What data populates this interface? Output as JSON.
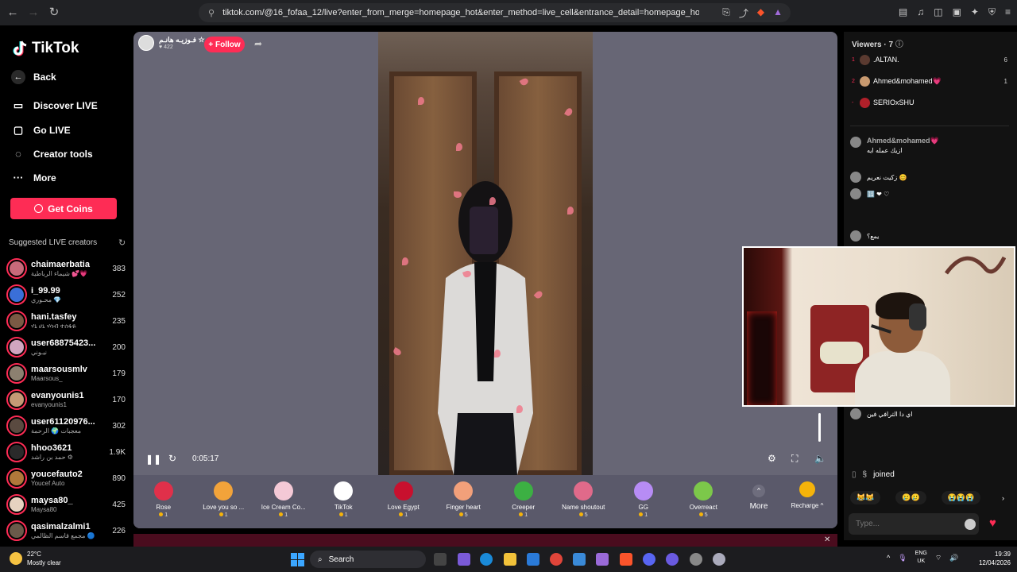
{
  "browser": {
    "url": "tiktok.com/@16_fofaa_12/live?enter_from_merge=homepage_hot&enter_method=live_cell&entrance_detail=homepage_hot_live_cell&from_pla..."
  },
  "sidebar": {
    "brand": "TikTok",
    "back": "Back",
    "nav": [
      "Discover LIVE",
      "Go LIVE",
      "Creator tools",
      "More"
    ],
    "get_coins": "Get Coins",
    "suggested_title": "Suggested LIVE creators",
    "creators": [
      {
        "name": "chaimaerbatia",
        "sub": "شيماء الرباطية 💕💗",
        "count": "383",
        "color": "#c86a7a"
      },
      {
        "name": "i_99.99",
        "sub": "محـوري 💎",
        "count": "252",
        "color": "#3a6fd8"
      },
      {
        "name": "hani.tasfey",
        "sub": "ሃኒ ሀኒ ሃሳብ ተሰፋዬ",
        "count": "235",
        "color": "#7a5a44"
      },
      {
        "name": "user68875423...",
        "sub": "نيـوني",
        "count": "200",
        "color": "#d1a6c0"
      },
      {
        "name": "maarsousmlv",
        "sub": "Maarsous_",
        "count": "179",
        "color": "#8c8070"
      },
      {
        "name": "evanyounis1",
        "sub": "evanyounis1",
        "count": "170",
        "color": "#c59a76"
      },
      {
        "name": "user61120976...",
        "sub": "معجبات 🌍 الرحمة",
        "count": "302",
        "color": "#5a4a40"
      },
      {
        "name": "hhoo3621",
        "sub": "حمد بن راشد ⚙",
        "count": "1.9K",
        "color": "#2a2a2a"
      },
      {
        "name": "youcefauto2",
        "sub": "Youcef Auto",
        "count": "890",
        "color": "#b0783a"
      },
      {
        "name": "maysa80_",
        "sub": "Maysa80",
        "count": "425",
        "color": "#e6d2c0"
      },
      {
        "name": "qasimalzalmi1",
        "sub": "مجمع قاسم الظالمي 🔵",
        "count": "226",
        "color": "#6a5a4a"
      }
    ]
  },
  "stream": {
    "host_name": "فـوزيـه هانـم ☆.",
    "likes": "422",
    "follow": "+ Follow",
    "time": "0:05:17"
  },
  "gifts": [
    {
      "name": "Rose",
      "cost": "1",
      "color": "#e0304a"
    },
    {
      "name": "Love you so ...",
      "cost": "1",
      "color": "#f2a33a"
    },
    {
      "name": "Ice Cream Co...",
      "cost": "1",
      "color": "#f4c9d6"
    },
    {
      "name": "TikTok",
      "cost": "1",
      "color": "#ffffff"
    },
    {
      "name": "Love Egypt",
      "cost": "1",
      "color": "#c8102e"
    },
    {
      "name": "Finger heart",
      "cost": "5",
      "color": "#f2a07a"
    },
    {
      "name": "Creeper",
      "cost": "1",
      "color": "#3cb043"
    },
    {
      "name": "Name shoutout",
      "cost": "5",
      "color": "#e06a8a"
    },
    {
      "name": "GG",
      "cost": "1",
      "color": "#b78cf5"
    },
    {
      "name": "Overreact",
      "cost": "5",
      "color": "#7cc84a"
    }
  ],
  "gift_bar": {
    "more": "More",
    "recharge": "Recharge ^"
  },
  "viewers": {
    "title": "Viewers · 7",
    "list": [
      {
        "rank": "1",
        "name": ".ALTAN.",
        "count": "6",
        "color": "#5a3a30"
      },
      {
        "rank": "2",
        "name": "Ahmed&mohamed💗",
        "count": "1",
        "color": "#c99a70"
      },
      {
        "rank": "-",
        "name": "SERIOxSHU",
        "count": "",
        "color": "#b0202a"
      }
    ]
  },
  "chat": [
    {
      "name": "Ahmed&mohamed💗",
      "text": "ازيك عمله ايه"
    },
    {
      "name": "",
      "text": "زكيت نعريم 😊"
    },
    {
      "name": "",
      "text": "🔢 ❤ ♡"
    },
    {
      "name": "",
      "text": "يمع؟"
    },
    {
      "name": "",
      "text": "اي دا الترافي فين"
    }
  ],
  "joined": "joined",
  "quick_reactions": [
    "😹😹",
    "🥲🥲",
    "😭😭😭"
  ],
  "input_placeholder": "Type...",
  "taskbar": {
    "temp": "22°C",
    "weather": "Mostly clear",
    "search": "Search",
    "lang1": "ENG",
    "lang2": "UK",
    "time": "19:39",
    "date": "12/04/2026"
  }
}
